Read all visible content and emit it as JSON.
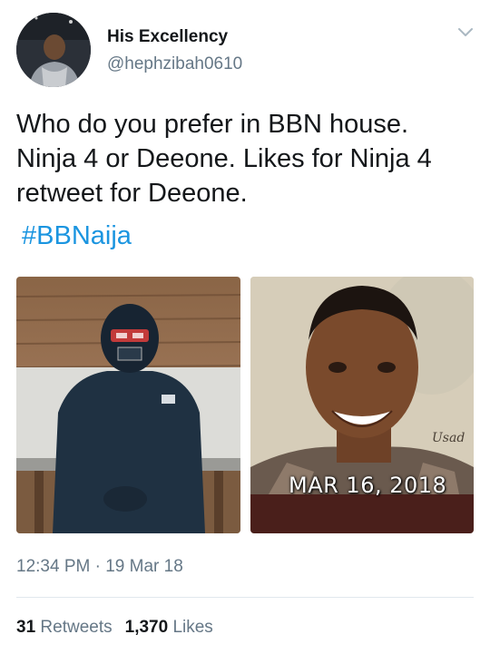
{
  "author": {
    "display_name": "His Excellency",
    "handle": "@hephzibah0610"
  },
  "tweet": {
    "text": "Who do you prefer in BBN house. Ninja 4 or Deeone. Likes for Ninja 4 retweet for Deeone.",
    "hashtag": "#BBNaija",
    "timestamp": "12:34 PM · 19 Mar 18"
  },
  "media": {
    "left_photo": "person-in-black-mask-photo",
    "right_photo": "smiling-man-portrait-photo",
    "right_photo_date_stamp": "MAR 16, 2018",
    "right_photo_signature": "Usad"
  },
  "stats": {
    "retweets_count": "31",
    "retweets_label": "Retweets",
    "likes_count": "1,370",
    "likes_label": "Likes"
  },
  "colors": {
    "link": "#1b95e0",
    "secondary_text": "#657786",
    "primary_text": "#14171a",
    "divider": "#e1e8ed"
  },
  "icons": {
    "menu": "chevron-down-icon"
  }
}
